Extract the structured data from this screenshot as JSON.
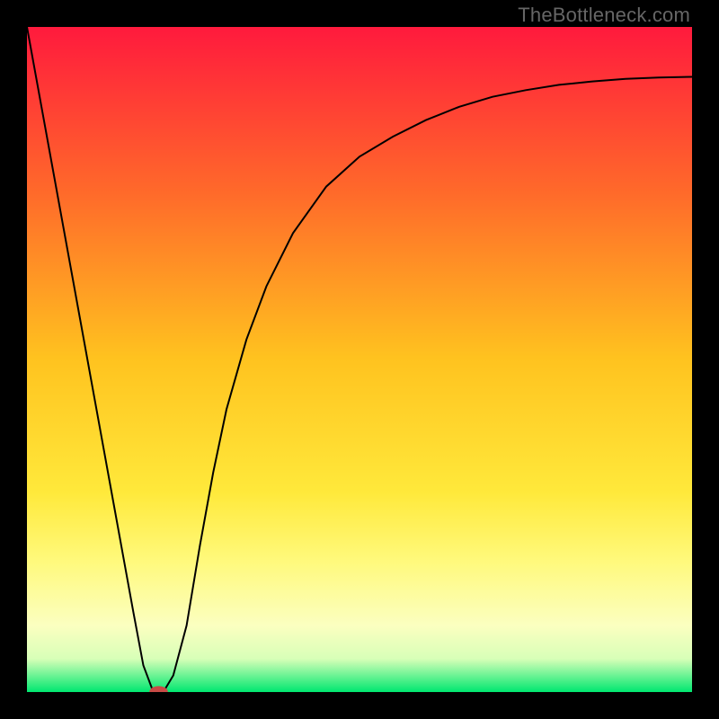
{
  "watermark": "TheBottleneck.com",
  "chart_data": {
    "type": "line",
    "title": "",
    "xlabel": "",
    "ylabel": "",
    "xlim": [
      0,
      100
    ],
    "ylim": [
      0,
      100
    ],
    "grid": false,
    "legend": false,
    "background_gradient": {
      "stops": [
        {
          "offset": 0.0,
          "color": "#ff1a3d"
        },
        {
          "offset": 0.25,
          "color": "#ff6a2a"
        },
        {
          "offset": 0.5,
          "color": "#ffc31f"
        },
        {
          "offset": 0.7,
          "color": "#ffe93b"
        },
        {
          "offset": 0.8,
          "color": "#fff97a"
        },
        {
          "offset": 0.9,
          "color": "#fbffc0"
        },
        {
          "offset": 0.95,
          "color": "#d8ffb8"
        },
        {
          "offset": 1.0,
          "color": "#00e770"
        }
      ]
    },
    "series": [
      {
        "name": "bottleneck-curve",
        "color": "#000000",
        "width": 2,
        "x": [
          0.0,
          4.0,
          8.0,
          12.0,
          16.0,
          17.5,
          19.0,
          20.5,
          22.0,
          24.0,
          26.0,
          28.0,
          30.0,
          33.0,
          36.0,
          40.0,
          45.0,
          50.0,
          55.0,
          60.0,
          65.0,
          70.0,
          75.0,
          80.0,
          85.0,
          90.0,
          95.0,
          100.0
        ],
        "y": [
          100.0,
          78.0,
          56.0,
          34.0,
          12.0,
          4.0,
          0.0,
          0.0,
          2.5,
          10.0,
          22.0,
          33.0,
          42.5,
          53.0,
          61.0,
          69.0,
          76.0,
          80.5,
          83.5,
          86.0,
          88.0,
          89.5,
          90.5,
          91.3,
          91.8,
          92.2,
          92.4,
          92.5
        ]
      }
    ],
    "marker": {
      "name": "optimal-point",
      "x": 19.8,
      "y": 0.0,
      "rx": 1.4,
      "ry": 0.9,
      "color": "#c94b46"
    }
  }
}
